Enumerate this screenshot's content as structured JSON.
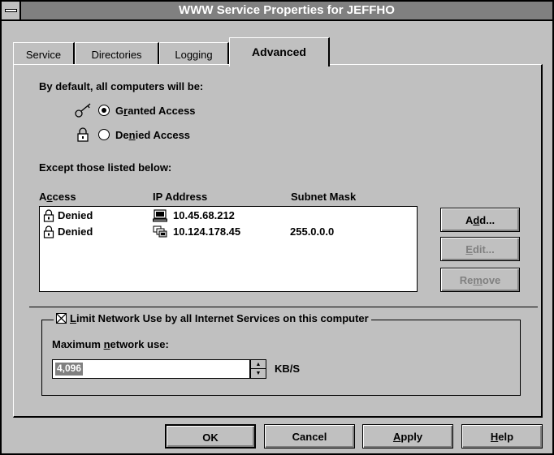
{
  "window": {
    "title": "WWW Service Properties for JEFFHO"
  },
  "tabs": [
    {
      "label": "Service"
    },
    {
      "label": "Directories"
    },
    {
      "label": "Logging"
    },
    {
      "label": "Advanced"
    }
  ],
  "advanced": {
    "default_heading": "By default, all computers will be:",
    "granted_label_pre": "G",
    "granted_label_mn": "r",
    "granted_label_post": "anted Access",
    "denied_label_pre": "De",
    "denied_label_mn": "n",
    "denied_label_post": "ied Access",
    "selected_option": "granted",
    "except_heading": "Except those listed below:",
    "columns": {
      "access_pre": "A",
      "access_mn": "c",
      "access_post": "cess",
      "ip": "IP Address",
      "mask": "Subnet Mask"
    },
    "rows": [
      {
        "access": "Denied",
        "ip": "10.45.68.212",
        "mask": "",
        "ip_icon": "computer-icon"
      },
      {
        "access": "Denied",
        "ip": "10.124.178.45",
        "mask": "255.0.0.0",
        "ip_icon": "computer-group-icon"
      }
    ],
    "buttons": {
      "add_pre": "A",
      "add_mn": "d",
      "add_post": "d...",
      "edit_pre": "",
      "edit_mn": "E",
      "edit_post": "dit...",
      "remove_pre": "Re",
      "remove_mn": "m",
      "remove_post": "ove"
    },
    "limit": {
      "checked": true,
      "label_pre": "",
      "label_mn": "L",
      "label_post": "imit Network Use by all Internet Services on this computer",
      "max_pre": "Maximum ",
      "max_mn": "n",
      "max_post": "etwork use:",
      "value": "4,096",
      "unit": "KB/S"
    }
  },
  "footer": {
    "ok": "OK",
    "cancel": "Cancel",
    "apply_pre": "",
    "apply_mn": "A",
    "apply_post": "pply",
    "help_pre": "",
    "help_mn": "H",
    "help_post": "elp"
  },
  "colors": {
    "face": "#c0c0c0",
    "titlebar": "#808080",
    "disabled_text": "#808080"
  }
}
